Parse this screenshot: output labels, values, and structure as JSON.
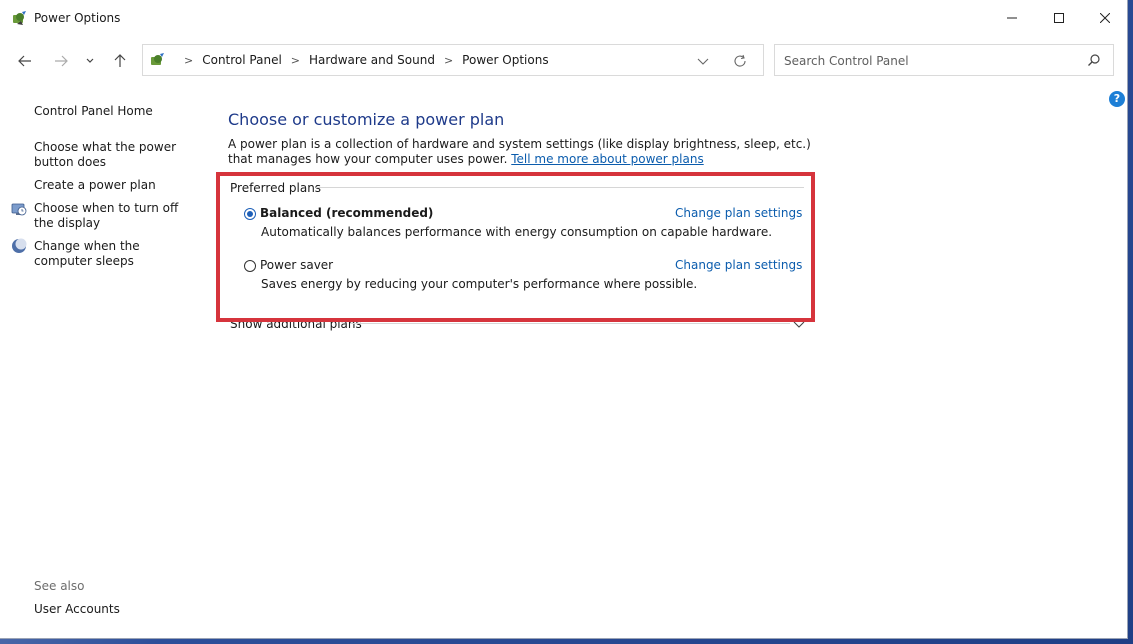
{
  "window": {
    "title": "Power Options"
  },
  "nav": {
    "breadcrumbs": [
      "Control Panel",
      "Hardware and Sound",
      "Power Options"
    ],
    "search_placeholder": "Search Control Panel"
  },
  "sidebar": {
    "home": "Control Panel Home",
    "links": [
      "Choose what the power button does",
      "Create a power plan",
      "Choose when to turn off the display",
      "Change when the computer sleeps"
    ],
    "see_also": "See also",
    "see_also_links": [
      "User Accounts"
    ]
  },
  "main": {
    "title": "Choose or customize a power plan",
    "description": "A power plan is a collection of hardware and system settings (like display brightness, sleep, etc.) that manages how your computer uses power.",
    "learn_more": "Tell me more about power plans",
    "preferred_label": "Preferred plans",
    "plans": [
      {
        "name": "Balanced (recommended)",
        "description": "Automatically balances performance with energy consumption on capable hardware.",
        "selected": true,
        "link": "Change plan settings"
      },
      {
        "name": "Power saver",
        "description": "Saves energy by reducing your computer's performance where possible.",
        "selected": false,
        "link": "Change plan settings"
      }
    ],
    "additional_label": "Show additional plans"
  },
  "icons": {
    "app": "power-options-icon",
    "back": "back-arrow-icon",
    "forward": "forward-arrow-icon",
    "recent": "chevron-down-icon",
    "up": "up-arrow-icon",
    "refresh": "refresh-icon",
    "search": "search-icon",
    "help": "help-icon"
  },
  "colors": {
    "highlight": "#d6343c",
    "link": "#0b5cad",
    "title": "#1e3a8a",
    "radio": "#1d5fb8"
  }
}
